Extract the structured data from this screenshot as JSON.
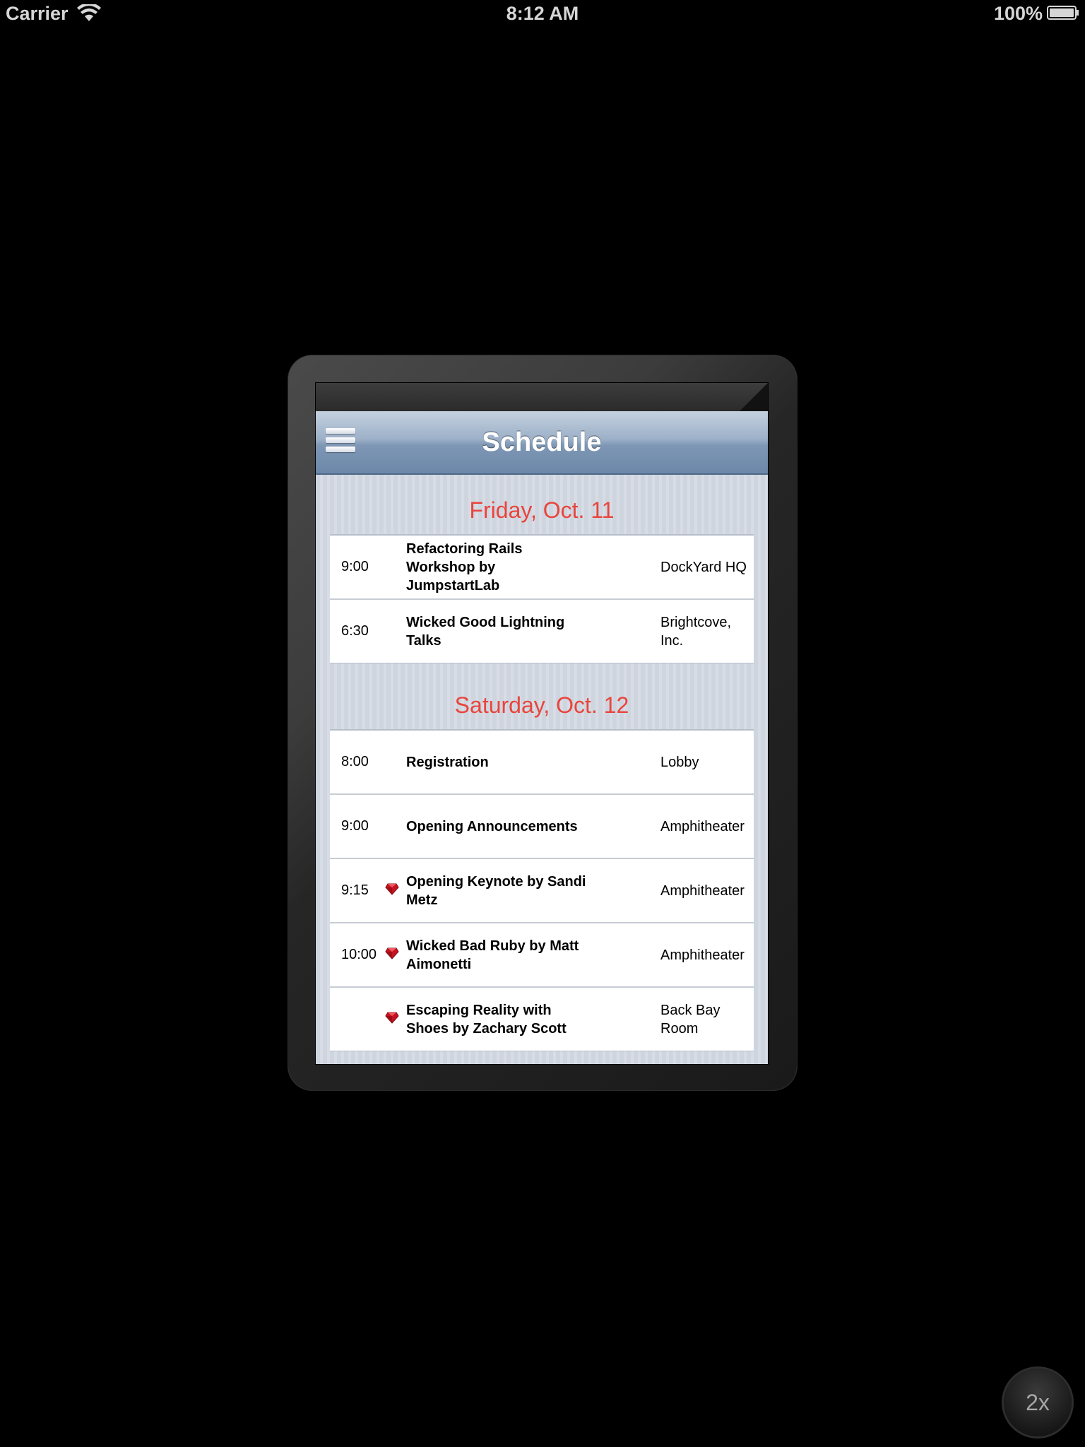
{
  "status_bar": {
    "carrier": "Carrier",
    "time": "8:12 AM",
    "battery": "100%"
  },
  "nav": {
    "title": "Schedule",
    "menu_icon": "hamburger-menu-icon"
  },
  "sections": [
    {
      "header": "Friday, Oct. 11",
      "rows": [
        {
          "time": "9:00",
          "ruby": false,
          "title": "Refactoring Rails Workshop by JumpstartLab",
          "location": "DockYard HQ"
        },
        {
          "time": "6:30",
          "ruby": false,
          "title": "Wicked Good Lightning Talks",
          "location": "Brightcove, Inc."
        }
      ]
    },
    {
      "header": "Saturday, Oct. 12",
      "rows": [
        {
          "time": "8:00",
          "ruby": false,
          "title": "Registration",
          "location": "Lobby"
        },
        {
          "time": "9:00",
          "ruby": false,
          "title": "Opening Announcements",
          "location": "Amphitheater"
        },
        {
          "time": "9:15",
          "ruby": true,
          "title": "Opening Keynote by Sandi Metz",
          "location": "Amphitheater"
        },
        {
          "time": "10:00",
          "ruby": true,
          "title": "Wicked Bad Ruby by Matt Aimonetti",
          "location": "Amphitheater"
        },
        {
          "time": "",
          "ruby": true,
          "title": "Escaping Reality with Shoes by Zachary Scott",
          "location": "Back Bay Room"
        }
      ]
    }
  ],
  "zoom_button": {
    "label": "2x"
  },
  "colors": {
    "section_header": "#e8453c",
    "nav_bar": "#7e97b5",
    "ruby": "#c8121f"
  }
}
